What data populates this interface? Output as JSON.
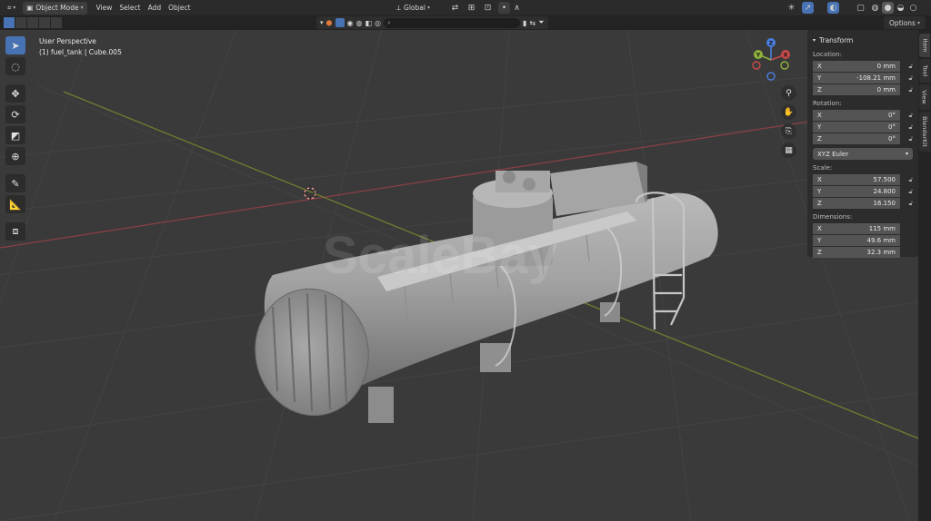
{
  "header": {
    "editor_icon": "editor-type-icon",
    "mode": "Object Mode",
    "menus": [
      "View",
      "Select",
      "Add",
      "Object"
    ],
    "transform_orientation": "Global"
  },
  "toolbar": {
    "search_placeholder": "",
    "options_label": "Options"
  },
  "viewport": {
    "perspective_label": "User Perspective",
    "object_label": "(1) fuel_tank | Cube.005",
    "watermark": "ScaleBay"
  },
  "gizmo": {
    "x": "X",
    "y": "Y",
    "z": "Z"
  },
  "transform_panel": {
    "title": "Transform",
    "location_label": "Location:",
    "location": [
      {
        "axis": "X",
        "value": "0 mm"
      },
      {
        "axis": "Y",
        "value": "-108.21 mm"
      },
      {
        "axis": "Z",
        "value": "0 mm"
      }
    ],
    "rotation_label": "Rotation:",
    "rotation": [
      {
        "axis": "X",
        "value": "0°"
      },
      {
        "axis": "Y",
        "value": "0°"
      },
      {
        "axis": "Z",
        "value": "0°"
      }
    ],
    "rotation_mode": "XYZ Euler",
    "scale_label": "Scale:",
    "scale": [
      {
        "axis": "X",
        "value": "57.500"
      },
      {
        "axis": "Y",
        "value": "24.800"
      },
      {
        "axis": "Z",
        "value": "16.150"
      }
    ],
    "dimensions_label": "Dimensions:",
    "dimensions": [
      {
        "axis": "X",
        "value": "115 mm"
      },
      {
        "axis": "Y",
        "value": "49.6 mm"
      },
      {
        "axis": "Z",
        "value": "32.3 mm"
      }
    ]
  },
  "side_tabs": [
    "Item",
    "Tool",
    "View",
    "BlenderKit"
  ],
  "colors": {
    "accent": "#4772b3",
    "x_axis": "#c84a4a",
    "y_axis": "#8fb33a",
    "z_axis": "#4a7fe0"
  }
}
